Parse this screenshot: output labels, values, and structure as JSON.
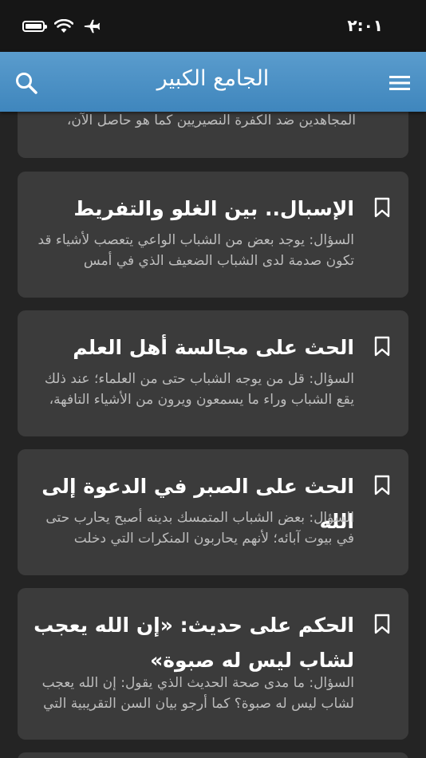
{
  "status_bar": {
    "time": "٢:٠١",
    "icons": [
      "battery-icon",
      "wifi-icon",
      "airplane-icon"
    ]
  },
  "app_bar": {
    "title": "الجامع الكبير",
    "icons": [
      "search-icon",
      "menu-icon"
    ]
  },
  "cards": [
    {
      "title": "",
      "excerpt": "المجاهدين ضد الكفرة النصيريين كما هو حاصل الآن،"
    },
    {
      "title": "الإسبال.. بين الغلو والتفريط",
      "excerpt": "السؤال: يوجد بعض من الشباب الواعي يتعصب لأشياء قد تكون صدمة لدى الشباب الضعيف الذي في أمس"
    },
    {
      "title": "الحث على مجالسة أهل العلم",
      "excerpt": "السؤال: قل من يوجه الشباب حتى من العلماء؛ عند ذلك يقع الشباب وراء ما يسمعون ويرون من الأشياء التافهة،"
    },
    {
      "title": "الحث على الصبر في الدعوة إلى الله",
      "excerpt": "السؤال: بعض الشباب المتمسك بدينه أصبح يحارب حتى في بيوت آبائه؛ لأنهم يحاربون المنكرات التي دخلت"
    },
    {
      "title": "الحكم على حديث: «إن الله يعجب لشاب ليس له صبوة»",
      "excerpt": "السؤال: ما مدى صحة الحديث الذي يقول: إن الله يعجب لشاب ليس له صبوة؟ كما أرجو بيان السن التقريبية التي"
    }
  ],
  "colors": {
    "app_bar": "#4a90c6",
    "card": "#3b3b3b",
    "background": "#242424",
    "excerpt": "#bdbdbd"
  }
}
